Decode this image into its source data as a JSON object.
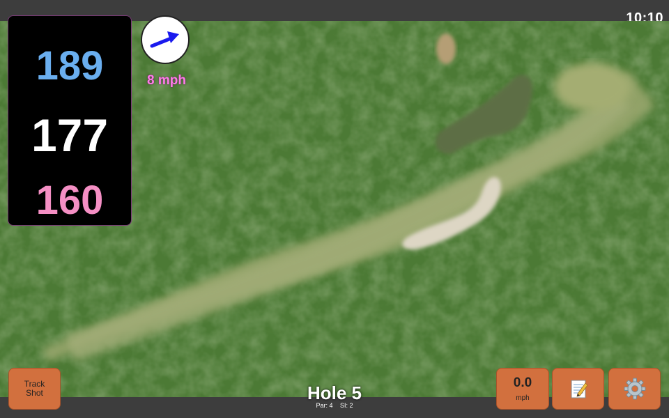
{
  "status_bar": {
    "time": "10:10"
  },
  "yardage": {
    "back": "189",
    "middle": "177",
    "front": "160"
  },
  "wind": {
    "speed": "8 mph",
    "arrow_color": "#1a1aee"
  },
  "hole": {
    "title": "Hole 5",
    "par": "Par: 4",
    "si": "SI: 2"
  },
  "buttons": {
    "track_shot": [
      "Track",
      "Shot"
    ],
    "speed_value": "0.0",
    "speed_unit": "mph",
    "notes_icon": "notepad-icon",
    "settings_icon": "gear-icon"
  },
  "colors": {
    "back": "#6aaeef",
    "middle": "#ffffff",
    "front": "#f48fc4",
    "accent_button": "#d2703e",
    "wind_label": "#ff7be9"
  }
}
